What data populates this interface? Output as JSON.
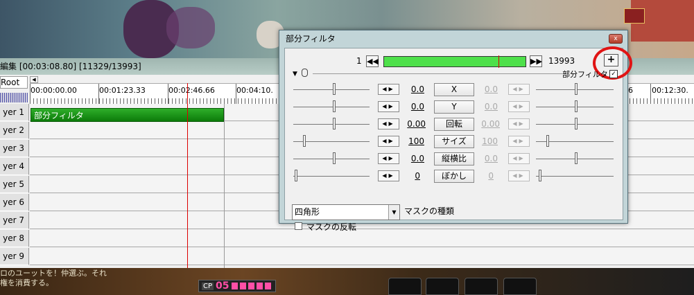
{
  "timeline": {
    "title": "編集 [00:03:08.80] [11329/13993]",
    "root_tab": "Root",
    "ruler_labels": [
      "00:00:00.00",
      "00:01:23.33",
      "00:02:46.66",
      "00:04:10.",
      "6",
      "00:12:30."
    ],
    "layers": [
      "yer 1",
      "yer 2",
      "yer 3",
      "yer 4",
      "yer 5",
      "yer 6",
      "yer 7",
      "yer 8",
      "yer 9"
    ],
    "clip_label": "部分フィルタ"
  },
  "dialog": {
    "title": "部分フィルタ",
    "close_label": "x",
    "frame_start": "1",
    "frame_end": "13993",
    "frame_position_fraction": 0.81,
    "first_button": "◀◀",
    "last_button": "▶▶",
    "add_button": "+",
    "filter_name": "部分フィルタ",
    "filter_enabled_mark": "✓",
    "params": [
      {
        "name": "X",
        "left": "0.0",
        "right": "0.0"
      },
      {
        "name": "Y",
        "left": "0.0",
        "right": "0.0"
      },
      {
        "name": "回転",
        "left": "0.00",
        "right": "0.00"
      },
      {
        "name": "サイズ",
        "left": "100",
        "right": "100"
      },
      {
        "name": "縦横比",
        "left": "0.0",
        "right": "0.0"
      },
      {
        "name": "ぼかし",
        "left": "0",
        "right": "0"
      }
    ],
    "arrow_label": "◀▶",
    "mask_type_value": "四角形",
    "mask_type_label": "マスクの種類",
    "invert_label": "マスクの反転"
  },
  "game_ui": {
    "bottom_text_1": "ロのユーットを！仲選ぶ。それ",
    "bottom_text_2": "権を消費する。",
    "cp_label": "CP",
    "cp_value": "05"
  },
  "colors": {
    "accent": "#4ee04a",
    "ring": "#e01414",
    "clip": "#1a8f17"
  }
}
